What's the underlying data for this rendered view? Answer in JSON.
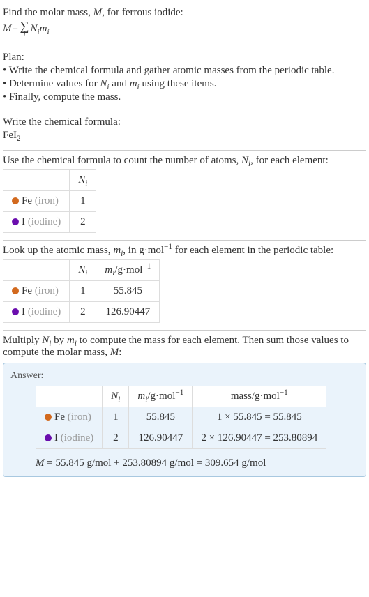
{
  "intro": {
    "line1": "Find the molar mass, ",
    "line1_M": "M",
    "line1_rest": ", for ferrous iodide:",
    "eq_lhs": "M",
    "eq_eq": " = ",
    "eq_sigma": "∑",
    "eq_sub": "i",
    "eq_rhs_N": "N",
    "eq_rhs_i1": "i",
    "eq_rhs_m": "m",
    "eq_rhs_i2": "i"
  },
  "plan": {
    "title": "Plan:",
    "b1": "• Write the chemical formula and gather atomic masses from the periodic table.",
    "b2a": "• Determine values for ",
    "b2_N": "N",
    "b2_i1": "i",
    "b2_and": " and ",
    "b2_m": "m",
    "b2_i2": "i",
    "b2b": " using these items.",
    "b3": "• Finally, compute the mass."
  },
  "formula": {
    "title": "Write the chemical formula:",
    "text": "FeI",
    "sub": "2"
  },
  "count": {
    "line_a": "Use the chemical formula to count the number of atoms, ",
    "line_N": "N",
    "line_i": "i",
    "line_b": ", for each element:",
    "header_N": "N",
    "header_i": "i",
    "fe_label": "Fe ",
    "fe_grey": "(iron)",
    "fe_val": "1",
    "i_label": "I ",
    "i_grey": "(iodine)",
    "i_val": "2"
  },
  "masses": {
    "line_a": "Look up the atomic mass, ",
    "line_m": "m",
    "line_i": "i",
    "line_b": ", in g·mol",
    "line_sup": "−1",
    "line_c": " for each element in the periodic table:",
    "hN": "N",
    "hN_i": "i",
    "hm": "m",
    "hm_i": "i",
    "hm_unit": "/g·mol",
    "hm_sup": "−1",
    "fe_N": "1",
    "fe_m": "55.845",
    "i_N": "2",
    "i_m": "126.90447"
  },
  "compute": {
    "line_a": "Multiply ",
    "line_N": "N",
    "line_i1": "i",
    "line_b": " by ",
    "line_m": "m",
    "line_i2": "i",
    "line_c": " to compute the mass for each element. Then sum those values to compute the molar mass, ",
    "line_M": "M",
    "line_d": ":"
  },
  "answer": {
    "title": "Answer:",
    "hN": "N",
    "hN_i": "i",
    "hm": "m",
    "hm_i": "i",
    "hm_unit": "/g·mol",
    "hm_sup": "−1",
    "hmass": "mass/g·mol",
    "hmass_sup": "−1",
    "fe_N": "1",
    "fe_m": "55.845",
    "fe_mass": "1 × 55.845 = 55.845",
    "i_N": "2",
    "i_m": "126.90447",
    "i_mass": "2 × 126.90447 = 253.80894",
    "final_M": "M",
    "final_rest": " = 55.845 g/mol + 253.80894 g/mol = 309.654 g/mol"
  }
}
